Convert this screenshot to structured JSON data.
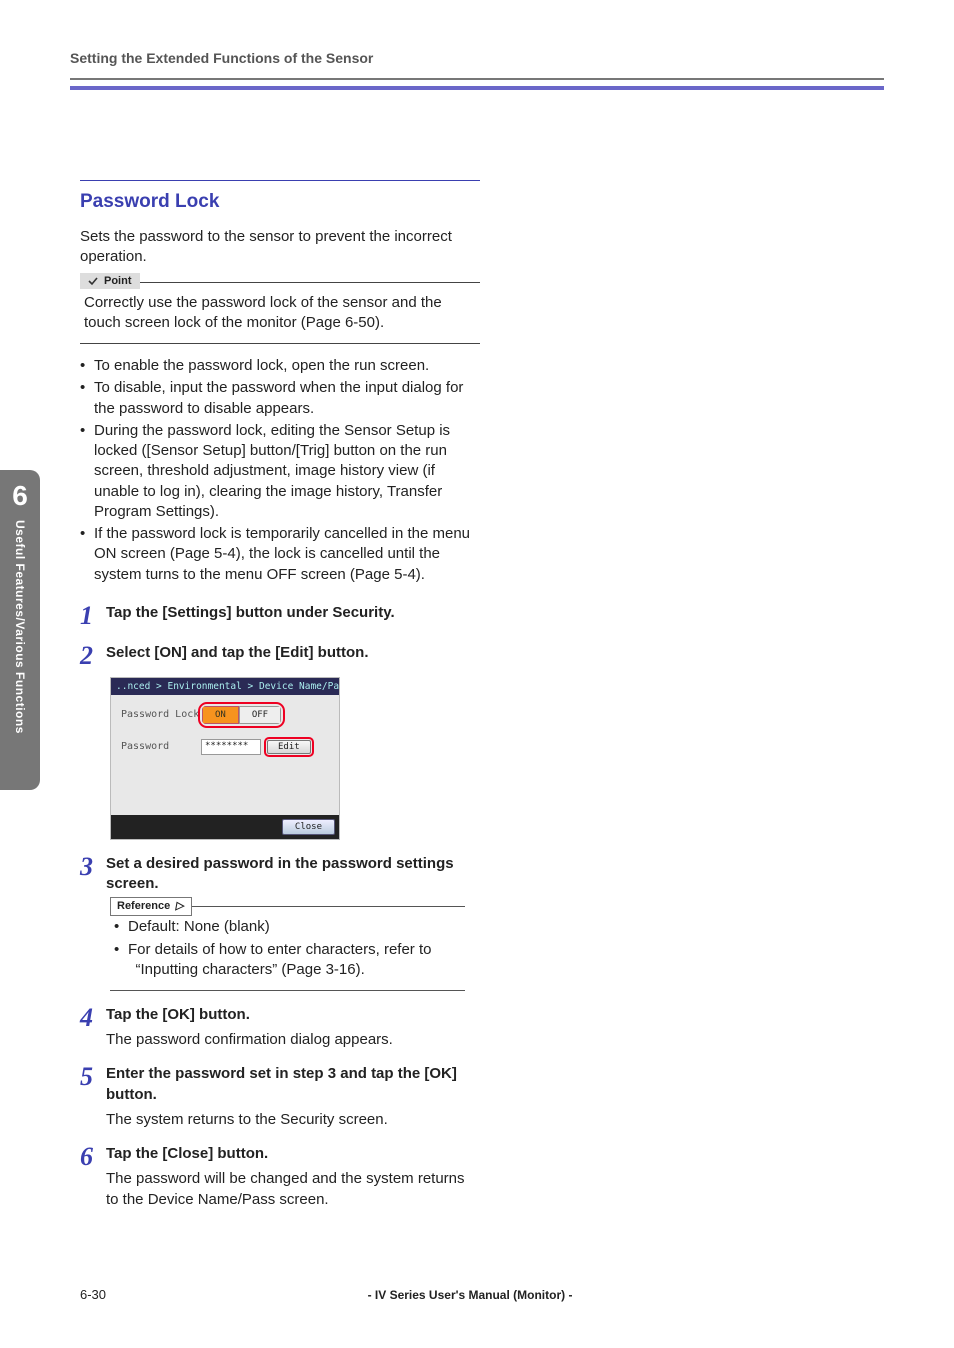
{
  "header": {
    "running_head": "Setting the Extended Functions of the Sensor"
  },
  "sidebar": {
    "chapter_number": "6",
    "chapter_title": "Useful Features/Various Functions"
  },
  "section": {
    "title": "Password Lock",
    "intro": "Sets the password to the sensor to prevent the incorrect operation."
  },
  "point": {
    "label": "Point",
    "text": "Correctly use the password lock of the sensor and the touch screen lock of the monitor (Page 6-50)."
  },
  "bullets": [
    "To enable the password lock, open the run screen.",
    "To disable, input the password when the input dialog for the password to disable appears.",
    "During the password lock, editing the Sensor Setup is locked ([Sensor Setup] button/[Trig] button on the run screen, threshold adjustment, image history view (if unable to log in), clearing the image history, Transfer Program Settings).",
    "If the password lock is temporarily cancelled in the menu ON screen (Page 5-4), the lock is cancelled until the system turns to the menu OFF screen (Page 5-4)."
  ],
  "steps": {
    "s1": {
      "num": "1",
      "title": "Tap the [Settings] button under Security."
    },
    "s2": {
      "num": "2",
      "title": "Select [ON] and tap the [Edit] button."
    },
    "s3": {
      "num": "3",
      "title": "Set a desired password in the password settings screen."
    },
    "s4": {
      "num": "4",
      "title": "Tap the [OK] button.",
      "text": "The password confirmation dialog appears."
    },
    "s5": {
      "num": "5",
      "title": "Enter the password set in step 3 and tap the [OK] button.",
      "text": "The system returns to the Security screen."
    },
    "s6": {
      "num": "6",
      "title": "Tap the [Close] button.",
      "text": "The password will be changed and the system returns to the Device Name/Pass screen."
    }
  },
  "device": {
    "breadcrumb": "..nced > Environmental > Device Name/Pass > Security",
    "row1_label": "Password Lock",
    "on_label": "ON",
    "off_label": "OFF",
    "row2_label": "Password",
    "password_mask": "********",
    "edit_label": "Edit",
    "close_label": "Close"
  },
  "reference": {
    "label": "Reference",
    "items": [
      "Default: None (blank)",
      "For details of how to enter characters, refer to  “Inputting characters” (Page 3-16)."
    ]
  },
  "footer": {
    "page": "6-30",
    "manual": "- IV Series User's Manual (Monitor) -"
  }
}
